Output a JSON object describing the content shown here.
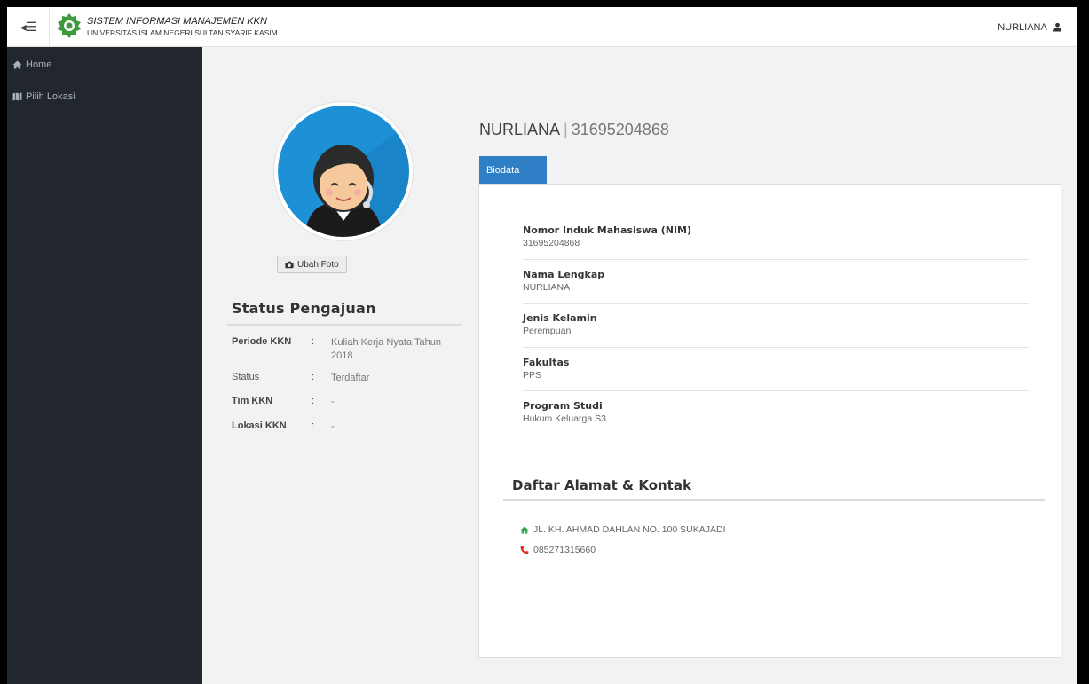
{
  "app": {
    "title": "SISTEM INFORMASI MANAJEMEN KKN",
    "subtitle": "UNIVERSITAS ISLAM NEGERI SULTAN SYARIF KASIM"
  },
  "topbar": {
    "toggle_icon": "sidebar-toggle-icon",
    "user_name": "NURLIANA",
    "user_icon": "user-icon"
  },
  "sidebar": {
    "items": [
      {
        "label": "Home",
        "icon": "home-icon"
      },
      {
        "label": "Pilih Lokasi",
        "icon": "map-icon"
      }
    ]
  },
  "profile": {
    "name": "NURLIANA",
    "separator": "|",
    "nim": "31695204868",
    "change_photo_label": "Ubah Foto"
  },
  "status": {
    "title": "Status Pengajuan",
    "rows": [
      {
        "label": "Periode KKN",
        "colon": ":",
        "value": "Kuliah Kerja Nyata Tahun 2018"
      },
      {
        "label": "Status",
        "colon": ":",
        "value": "Terdaftar"
      },
      {
        "label": "Tim KKN",
        "colon": ":",
        "value": "-"
      },
      {
        "label": "Lokasi KKN",
        "colon": ":",
        "value": "-"
      }
    ]
  },
  "tabs": [
    {
      "label": "Biodata",
      "active": true
    }
  ],
  "biodata": [
    {
      "label": "Nomor Induk Mahasiswa (NIM)",
      "value": "31695204868"
    },
    {
      "label": "Nama Lengkap",
      "value": "NURLIANA"
    },
    {
      "label": "Jenis Kelamin",
      "value": "Perempuan"
    },
    {
      "label": "Fakultas",
      "value": "PPS"
    },
    {
      "label": "Program Studi",
      "value": "Hukum Keluarga S3"
    }
  ],
  "contact": {
    "title": "Daftar Alamat & Kontak",
    "address": "JL. KH. AHMAD DAHLAN NO. 100 SUKAJADI",
    "phone": "085271315660"
  },
  "colors": {
    "sidebar_bg": "#22272d",
    "tab_active": "#2f7fc7",
    "home_icon": "#3aa856",
    "phone_icon": "#d9302c",
    "logo_green": "#3e9a3a"
  }
}
